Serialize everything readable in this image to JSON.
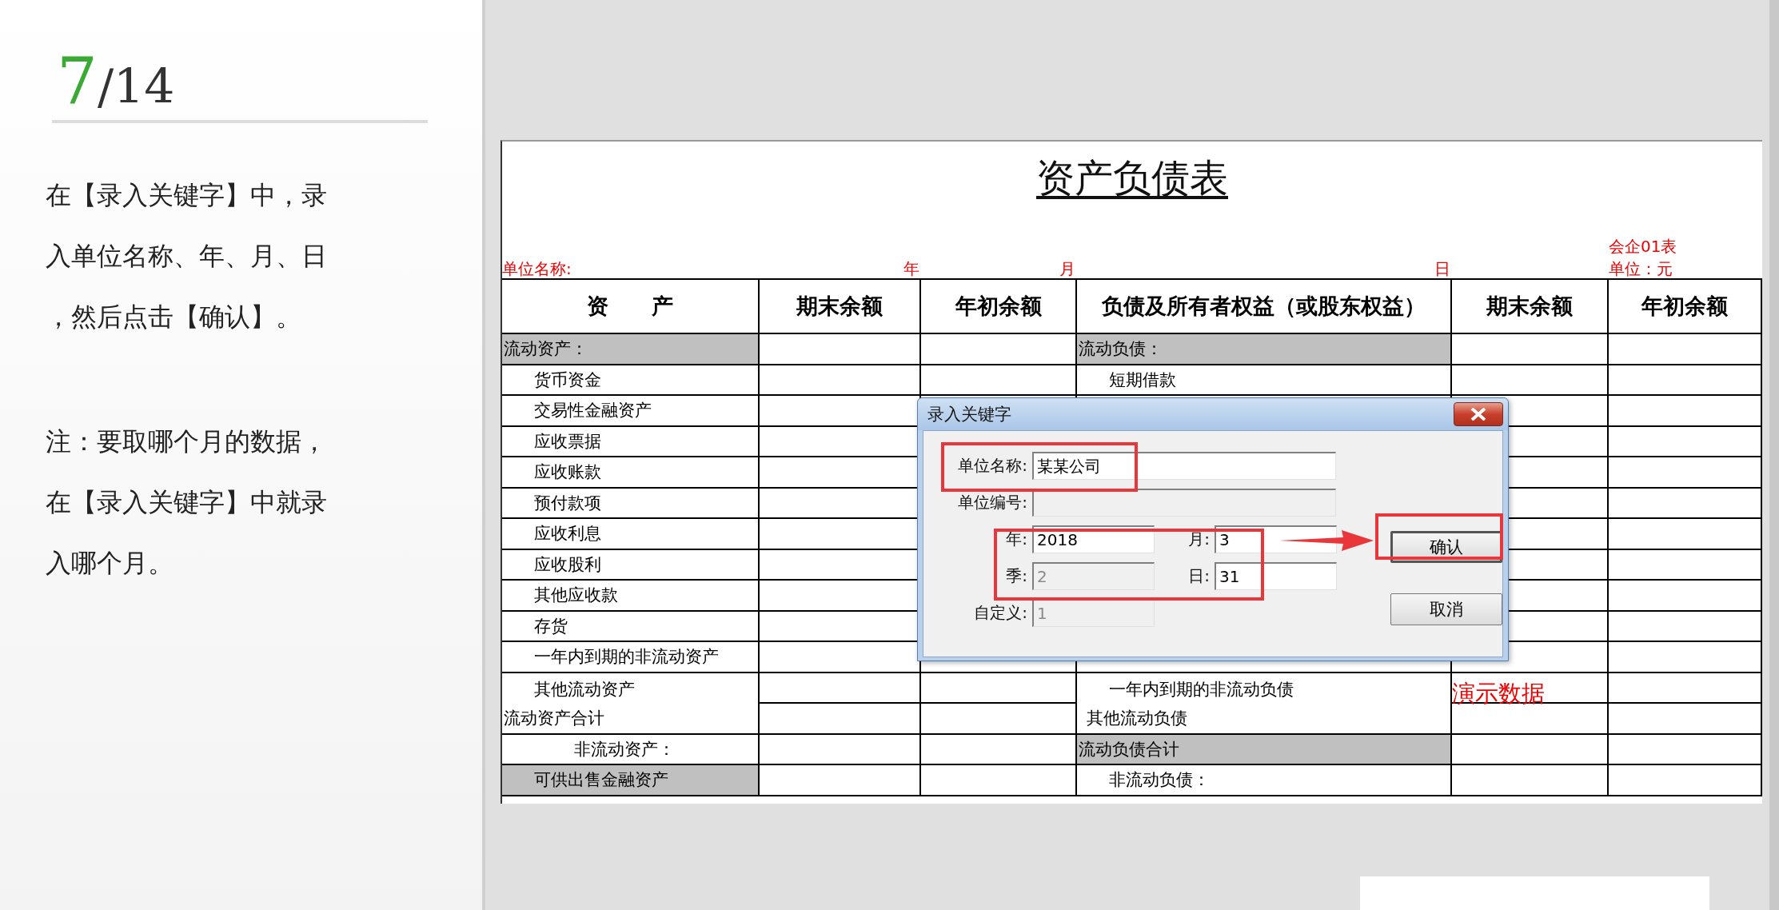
{
  "slide": {
    "page_current": "7",
    "page_total": "/14",
    "paragraphs": [
      {
        "lines": [
          "在【录入关键字】中，录",
          "入单位名称、年、月、日",
          "，然后点击【确认】。"
        ]
      },
      {
        "lines": [
          "注：要取哪个月的数据，",
          "在【录入关键字】中就录",
          "入哪个月。"
        ]
      }
    ]
  },
  "sheet": {
    "title": "资产负债表",
    "form_code": "会企01表",
    "unit": "单位：元",
    "header_labels": [
      "单位名称:",
      "年",
      "月",
      "日"
    ],
    "columns": [
      "资　　产",
      "期末余额",
      "年初余额",
      "负债及所有者权益（或股东权益）",
      "期末余额",
      "年初余额"
    ],
    "rows": [
      {
        "left": {
          "text": "流动资产：",
          "kind": "section",
          "shaded": true
        },
        "right": {
          "text": "流动负债：",
          "kind": "section",
          "shaded": true
        }
      },
      {
        "left": {
          "text": "货币资金",
          "kind": "item",
          "shaded": false
        },
        "right": {
          "text": "短期借款",
          "kind": "item",
          "shaded": false
        }
      },
      {
        "left": {
          "text": "交易性金融资产",
          "kind": "item",
          "shaded": false
        }
      },
      {
        "left": {
          "text": "应收票据",
          "kind": "item",
          "shaded": false
        }
      },
      {
        "left": {
          "text": "应收账款",
          "kind": "item",
          "shaded": false
        }
      },
      {
        "left": {
          "text": "预付款项",
          "kind": "item",
          "shaded": false
        }
      },
      {
        "left": {
          "text": "应收利息",
          "kind": "item",
          "shaded": false
        }
      },
      {
        "left": {
          "text": "应收股利",
          "kind": "item",
          "shaded": false
        }
      },
      {
        "left": {
          "text": "其他应收款",
          "kind": "item",
          "shaded": false
        }
      },
      {
        "left": {
          "text": "存货",
          "kind": "item",
          "shaded": false
        }
      },
      {
        "left": {
          "text": "一年内到期的非流动资产",
          "kind": "item",
          "shaded": false
        }
      },
      {
        "left": {
          "text": "其他流动资产",
          "kind": "item",
          "shaded": false
        },
        "right": {
          "text": "一年内到期的非流动负债",
          "kind": "item",
          "shaded": false
        },
        "note": "演示数据"
      },
      {
        "left": {
          "text": "流动资产合计",
          "kind": "total",
          "shaded": false
        },
        "right": {
          "text": "其他流动负债",
          "kind": "minor",
          "shaded": false
        }
      },
      {
        "left": {
          "text": "非流动资产：",
          "kind": "subsection",
          "shaded": false
        },
        "right": {
          "text": "流动负债合计",
          "kind": "total",
          "shaded": true
        }
      },
      {
        "left": {
          "text": "可供出售金融资产",
          "kind": "item",
          "shaded": true
        },
        "right": {
          "text": "非流动负债：",
          "kind": "item",
          "shaded": false
        }
      }
    ]
  },
  "dialog": {
    "title": "录入关键字",
    "fields": [
      {
        "label": "单位名称:",
        "value": "某某公司",
        "kind": "wide",
        "disabled": false
      },
      {
        "label": "单位编号:",
        "kind": "wide",
        "disabled": true
      },
      {
        "label": "年:",
        "value": "2018",
        "kind": "half",
        "disabled": false
      },
      {
        "label": "月:",
        "value": "3",
        "kind": "half",
        "disabled": false
      },
      {
        "label": "季:",
        "value": "2",
        "kind": "half",
        "disabled": true
      },
      {
        "label": "日:",
        "value": "31",
        "kind": "half",
        "disabled": false
      },
      {
        "label": "自定义:",
        "value": "1",
        "kind": "half",
        "disabled": true
      }
    ],
    "buttons": [
      {
        "label": "确认",
        "default": true
      },
      {
        "label": "取消",
        "default": false
      }
    ]
  }
}
